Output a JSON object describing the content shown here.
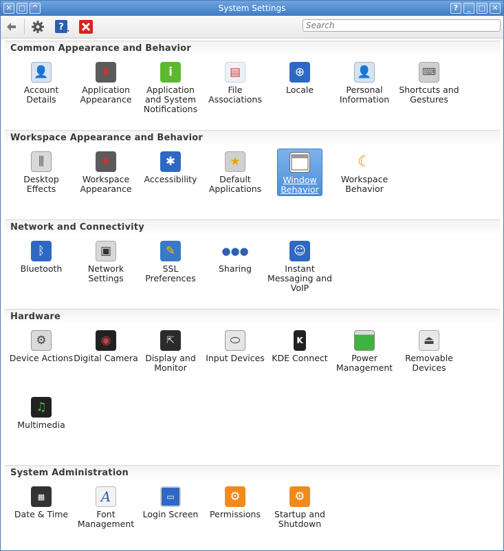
{
  "window": {
    "title": "System Settings"
  },
  "toolbar": {
    "search_placeholder": "Search"
  },
  "sections": [
    {
      "title": "Common Appearance and Behavior",
      "items": [
        {
          "label": "Account Details"
        },
        {
          "label": "Application Appearance"
        },
        {
          "label": "Application and System Notifications"
        },
        {
          "label": "File Associations"
        },
        {
          "label": "Locale"
        },
        {
          "label": "Personal Information"
        },
        {
          "label": "Shortcuts and Gestures"
        }
      ]
    },
    {
      "title": "Workspace Appearance and Behavior",
      "items": [
        {
          "label": "Desktop Effects"
        },
        {
          "label": "Workspace Appearance"
        },
        {
          "label": "Accessibility"
        },
        {
          "label": "Default Applications"
        },
        {
          "label": "Window Behavior",
          "selected": true
        },
        {
          "label": "Workspace Behavior"
        }
      ]
    },
    {
      "title": "Network and Connectivity",
      "items": [
        {
          "label": "Bluetooth"
        },
        {
          "label": "Network Settings"
        },
        {
          "label": "SSL Preferences"
        },
        {
          "label": "Sharing"
        },
        {
          "label": "Instant Messaging and VoIP"
        }
      ]
    },
    {
      "title": "Hardware",
      "items": [
        {
          "label": "Device Actions"
        },
        {
          "label": "Digital Camera"
        },
        {
          "label": "Display and Monitor"
        },
        {
          "label": "Input Devices"
        },
        {
          "label": "KDE Connect"
        },
        {
          "label": "Power Management"
        },
        {
          "label": "Removable Devices"
        },
        {
          "label": "Multimedia"
        }
      ]
    },
    {
      "title": "System Administration",
      "items": [
        {
          "label": "Date & Time"
        },
        {
          "label": "Font Management"
        },
        {
          "label": "Login Screen"
        },
        {
          "label": "Permissions"
        },
        {
          "label": "Startup and Shutdown"
        }
      ]
    }
  ],
  "icons": {
    "account-details": "person-card-icon",
    "application-appearance": "suit-icon",
    "notifications": "info-bubble-icon",
    "file-associations": "file-types-icon",
    "locale": "globe-flag-icon",
    "personal-information": "person-card-icon",
    "shortcuts": "keyboard-icon"
  },
  "colors": {
    "titlebar": "#3f7bc4",
    "selection": "#4f8fd9",
    "close_button": "#d9241c"
  }
}
